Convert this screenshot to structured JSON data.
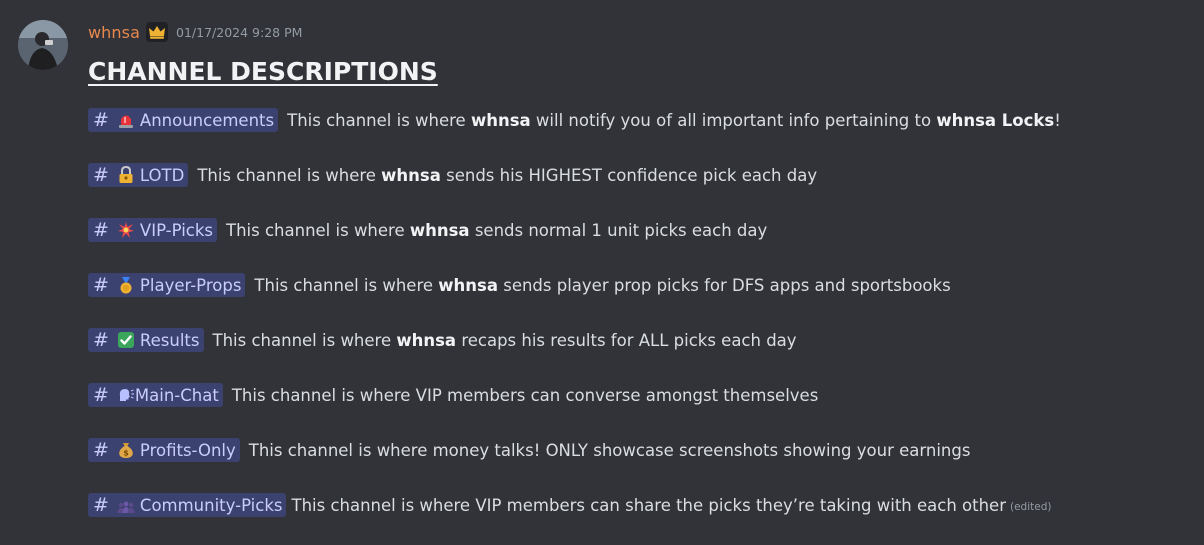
{
  "message": {
    "author": {
      "name": "whnsa",
      "badge_icon": "crown-icon",
      "name_color": "#e8884e"
    },
    "timestamp": "01/17/2024 9:28 PM",
    "title": "CHANNEL DESCRIPTIONS",
    "channels": [
      {
        "icon": "rotating-light-icon",
        "name": "Announcements",
        "desc_pre": "This channel is where ",
        "bold1": "whnsa",
        "desc_mid": " will notify you of all important info pertaining to ",
        "bold2": "whnsa Locks",
        "desc_post": "!"
      },
      {
        "icon": "lock-icon",
        "name": "LOTD",
        "desc_pre": "This channel is where ",
        "bold1": "whnsa",
        "desc_mid": " sends his HIGHEST confidence pick each day"
      },
      {
        "icon": "explosion-icon",
        "name": "VIP-Picks",
        "desc_pre": "This channel is where ",
        "bold1": "whnsa",
        "desc_mid": " sends normal 1 unit picks each day"
      },
      {
        "icon": "medal-icon",
        "name": "Player-Props",
        "desc_pre": "This channel is where ",
        "bold1": "whnsa",
        "desc_mid": " sends player prop picks for DFS apps and sportsbooks"
      },
      {
        "icon": "check-mark-icon",
        "name": "Results",
        "desc_pre": "This channel is where ",
        "bold1": "whnsa",
        "desc_mid": " recaps his results for ALL picks each day"
      },
      {
        "icon": "speaking-head-icon",
        "name": "Main-Chat",
        "desc_pre": "This channel is where VIP members can converse amongst themselves"
      },
      {
        "icon": "money-bag-icon",
        "name": "Profits-Only",
        "desc_pre": "This channel is where money talks! ONLY showcase screenshots showing your earnings"
      },
      {
        "icon": "people-icon",
        "name": "Community-Picks",
        "desc_pre": "This channel is where VIP members can share the picks they’re taking with each other",
        "edited": "(edited)"
      }
    ]
  },
  "colors": {
    "background": "#313338",
    "mention_bg": "#3c4270",
    "mention_text": "#c9cdfb",
    "text": "#dbdee1",
    "muted": "#949ba4"
  }
}
